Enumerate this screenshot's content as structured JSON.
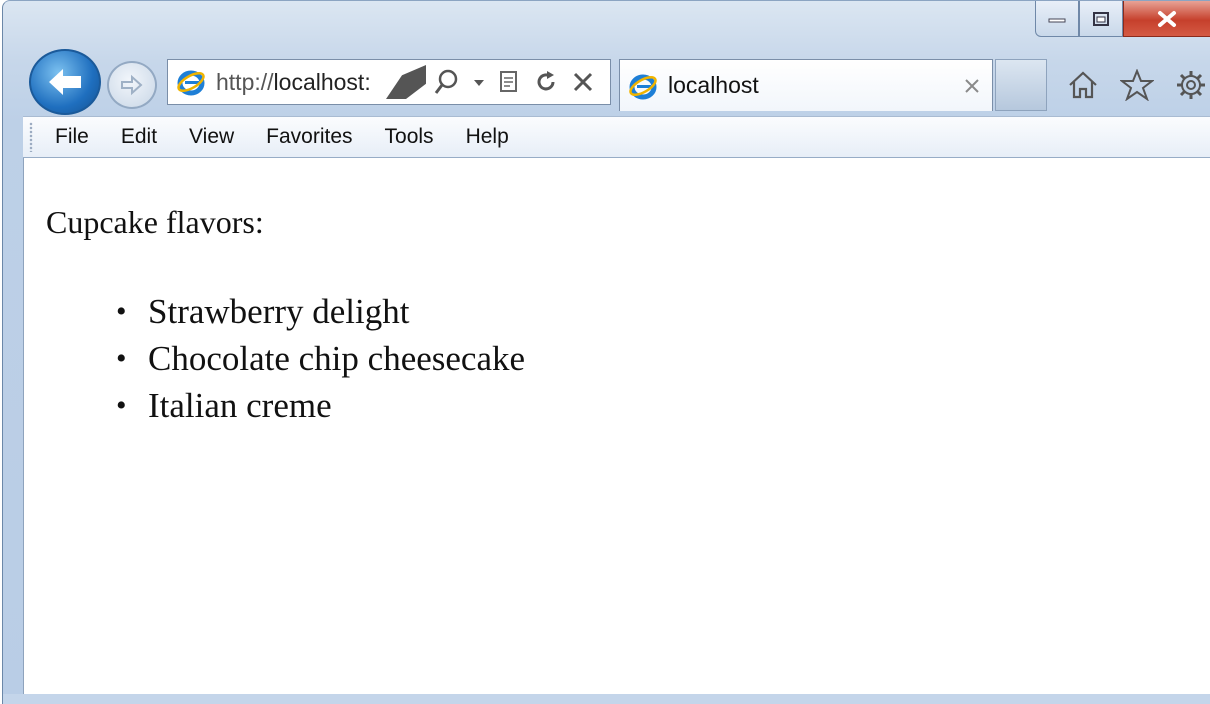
{
  "browser": {
    "address_url_prefix": "http://",
    "address_url_host": "localhost:",
    "tab_title": "localhost",
    "menu": [
      "File",
      "Edit",
      "View",
      "Favorites",
      "Tools",
      "Help"
    ],
    "icons": {
      "back": "back-arrow-icon",
      "forward": "forward-arrow-icon",
      "search": "search-icon",
      "compat": "compatibility-view-icon",
      "refresh": "refresh-icon",
      "stop": "stop-icon",
      "home": "home-icon",
      "favorites": "star-icon",
      "tools": "gear-icon"
    },
    "colors": {
      "accent": "#1f6fbf",
      "close_button": "#c6402c"
    }
  },
  "page": {
    "heading": "Cupcake flavors:",
    "flavors": [
      "Strawberry delight",
      "Chocolate chip cheesecake",
      "Italian creme"
    ]
  }
}
